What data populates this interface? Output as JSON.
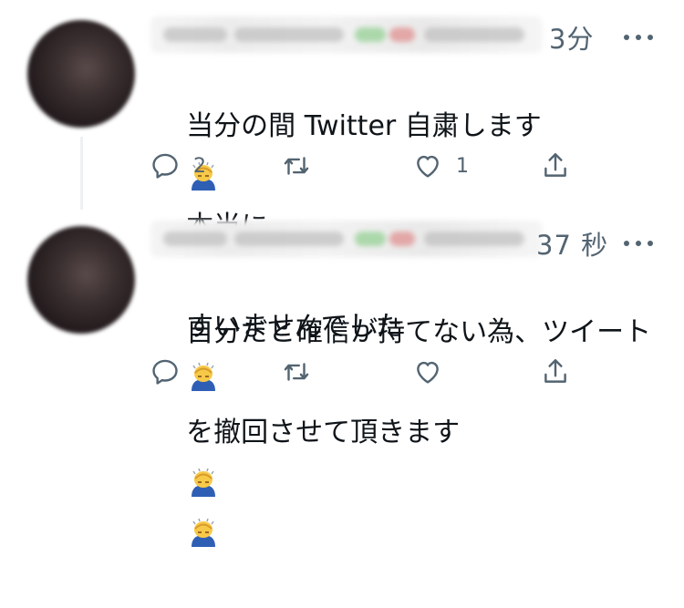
{
  "tweets": [
    {
      "timestamp": "3分",
      "text_line1": "当分の間 Twitter 自粛します",
      "text_line1_tail": "本当に",
      "text_line2": "すいませんでした",
      "reply_count": "2",
      "retweet_count": "",
      "like_count": "1",
      "emoji_after_line1": "person-bowing-emoji",
      "emoji_after_line2": "person-bowing-emoji"
    },
    {
      "timestamp": "37 秒",
      "text_line1": "自分だと確信が持てない為、ツイート",
      "text_line2": "を撤回させて頂きます",
      "reply_count": "",
      "retweet_count": "",
      "like_count": "",
      "emoji_after_line2": [
        "person-bowing-emoji",
        "person-bowing-emoji"
      ]
    }
  ],
  "colors": {
    "text": "#0f1419",
    "secondary": "#536471",
    "emoji_skin": "#f7c948",
    "emoji_shirt": "#2f5fb5"
  }
}
